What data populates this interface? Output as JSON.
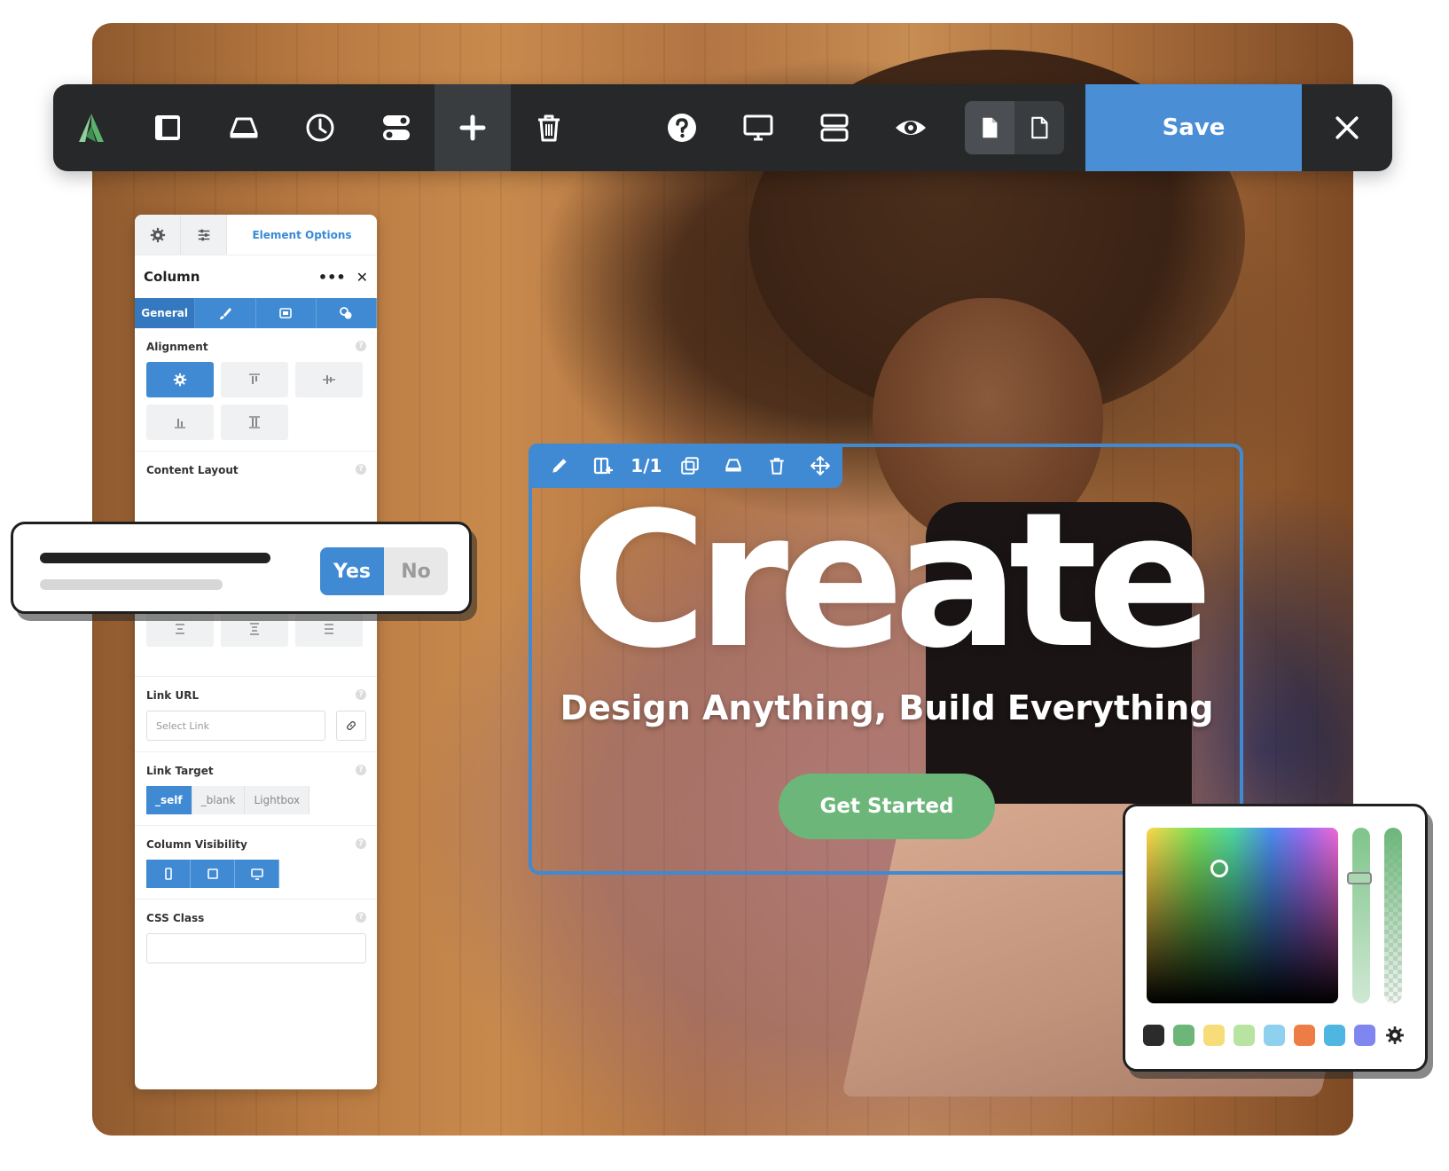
{
  "toolbar": {
    "save_label": "Save",
    "buttons": [
      "logo",
      "sidebar",
      "eraser",
      "history",
      "toggles",
      "add",
      "delete",
      "help",
      "desktop",
      "layers",
      "preview",
      "page-filled",
      "page"
    ]
  },
  "panel": {
    "tab_title": "Element Options",
    "title": "Column",
    "menu": "•••",
    "close": "✕",
    "sub_tabs": {
      "general": "General"
    },
    "alignment_label": "Alignment",
    "content_layout_label": "Content Layout",
    "link_url_label": "Link URL",
    "link_url_placeholder": "Select Link",
    "link_target_label": "Link Target",
    "link_target_options": [
      "_self",
      "_blank",
      "Lightbox"
    ],
    "link_target_selected": "_self",
    "column_visibility_label": "Column Visibility",
    "css_class_label": "CSS Class",
    "help": "?"
  },
  "yes_no": {
    "yes": "Yes",
    "no": "No",
    "selected": "Yes"
  },
  "selection": {
    "size_label": "1/1"
  },
  "hero": {
    "title": "Create",
    "subtitle": "Design Anything, Build Everything",
    "cta": "Get Started"
  },
  "color_picker": {
    "swatches": [
      "#2b2b2b",
      "#6cb67a",
      "#f7dc7a",
      "#b8e3a0",
      "#8fd0ef",
      "#ee7d45",
      "#4eb6e0",
      "#7f86ef"
    ]
  },
  "colors": {
    "accent": "#3f8ad3",
    "toolbar_bg": "#262829",
    "save_bg": "#4a8fd6",
    "cta_bg": "#6cb67a",
    "logo_green": "#5ab26c"
  }
}
